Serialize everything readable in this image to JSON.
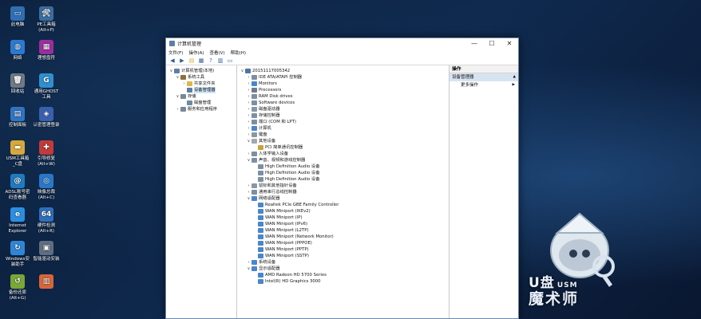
{
  "desktop": {
    "icons": [
      {
        "label": "此电脑",
        "color": "#2f6fb3",
        "glyph": "▭"
      },
      {
        "label": "PE工具箱\n(Alt+P)",
        "color": "#3b6ea0",
        "glyph": "🛠"
      },
      {
        "label": "网络",
        "color": "#2b7ad1",
        "glyph": "◍"
      },
      {
        "label": "理想盘符",
        "color": "#9a2f9e",
        "glyph": "▦"
      },
      {
        "label": "回收站",
        "color": "#6f7a86",
        "glyph": "🗑"
      },
      {
        "label": "通用GHOST\n工具",
        "color": "#2f8fd0",
        "glyph": "G"
      },
      {
        "label": "控制面板",
        "color": "#2f75c4",
        "glyph": "▤"
      },
      {
        "label": "认密管理登录",
        "color": "#3a5fae",
        "glyph": "◈"
      },
      {
        "label": "USM工具箱\n_C盘",
        "color": "#d8a93a",
        "glyph": "▬"
      },
      {
        "label": "引导修复\n(Alt+W)",
        "color": "#c23a3a",
        "glyph": "✚"
      },
      {
        "label": "ADSL账号密\n码查看器",
        "color": "#1f7bc0",
        "glyph": "@"
      },
      {
        "label": "映像总裁\n(Alt+C)",
        "color": "#2a77c9",
        "glyph": "◎"
      },
      {
        "label": "Internet\nExplorer",
        "color": "#2a8fe0",
        "glyph": "e"
      },
      {
        "label": "硬件检测\n(Alt+R)",
        "color": "#2e6fbb",
        "glyph": "64"
      },
      {
        "label": "Windows安\n装助手",
        "color": "#2f86d6",
        "glyph": "↻"
      },
      {
        "label": "智能驱动安装",
        "color": "#5f6f82",
        "glyph": "▣"
      },
      {
        "label": "备份还原\n(Alt+G)",
        "color": "#7aa836",
        "glyph": "↺"
      },
      {
        "label": "",
        "color": "#d4663a",
        "glyph": "▥"
      }
    ]
  },
  "window": {
    "title": "计算机管理",
    "controls": {
      "minimize": "—",
      "maximize": "☐",
      "close": "✕"
    },
    "menu": [
      "文件(F)",
      "操作(A)",
      "查看(V)",
      "帮助(H)"
    ],
    "toolbar_icons": [
      "back-arrow-icon",
      "forward-arrow-icon",
      "folder-up-icon",
      "properties-icon",
      "help-icon",
      "panel-icon",
      "monitor-icon"
    ],
    "left_tree": [
      {
        "label": "计算机管理(本地)",
        "indent": 0,
        "exp": "∨",
        "color": "#5c7fa8"
      },
      {
        "label": "系统工具",
        "indent": 1,
        "exp": "∨",
        "color": "#8c6f3a"
      },
      {
        "label": "共享文件夹",
        "indent": 2,
        "exp": "›",
        "color": "#e0b64a"
      },
      {
        "label": "设备管理器",
        "indent": 2,
        "exp": "",
        "color": "#5a7ea6",
        "selected": true
      },
      {
        "label": "存储",
        "indent": 1,
        "exp": "∨",
        "color": "#7a8796"
      },
      {
        "label": "磁盘管理",
        "indent": 2,
        "exp": "",
        "color": "#6f8aa5"
      },
      {
        "label": "服务和应用程序",
        "indent": 1,
        "exp": "›",
        "color": "#7a8796"
      }
    ],
    "device_tree": [
      {
        "label": "20151117005342",
        "indent": 0,
        "exp": "∨",
        "color": "#4f74a3"
      },
      {
        "label": "IDE ATA/ATAPI 控制器",
        "indent": 1,
        "exp": "›",
        "color": "#7d8fa1"
      },
      {
        "label": "Monitors",
        "indent": 1,
        "exp": "›",
        "color": "#4a86c9"
      },
      {
        "label": "Processors",
        "indent": 1,
        "exp": "›",
        "color": "#6b7c8c"
      },
      {
        "label": "RAM Disk drives",
        "indent": 1,
        "exp": "›",
        "color": "#7d8fa1"
      },
      {
        "label": "Software devices",
        "indent": 1,
        "exp": "›",
        "color": "#7d8fa1"
      },
      {
        "label": "磁盘驱动器",
        "indent": 1,
        "exp": "›",
        "color": "#8a96a3"
      },
      {
        "label": "存储控制器",
        "indent": 1,
        "exp": "›",
        "color": "#7d8fa1"
      },
      {
        "label": "端口 (COM 和 LPT)",
        "indent": 1,
        "exp": "›",
        "color": "#7d8fa1"
      },
      {
        "label": "计算机",
        "indent": 1,
        "exp": "›",
        "color": "#4a86c9"
      },
      {
        "label": "键盘",
        "indent": 1,
        "exp": "›",
        "color": "#8a96a3"
      },
      {
        "label": "其他设备",
        "indent": 1,
        "exp": "∨",
        "color": "#a0a8b0"
      },
      {
        "label": "PCI 简单通讯控制器",
        "indent": 2,
        "exp": "",
        "color": "#c9a23a"
      },
      {
        "label": "人体学输入设备",
        "indent": 1,
        "exp": "›",
        "color": "#7d8fa1"
      },
      {
        "label": "声音、视频和游戏控制器",
        "indent": 1,
        "exp": "∨",
        "color": "#7d8fa1"
      },
      {
        "label": "High Definition Audio 设备",
        "indent": 2,
        "exp": "",
        "color": "#7d8fa1"
      },
      {
        "label": "High Definition Audio 设备",
        "indent": 2,
        "exp": "",
        "color": "#7d8fa1"
      },
      {
        "label": "High Definition Audio 设备",
        "indent": 2,
        "exp": "",
        "color": "#7d8fa1"
      },
      {
        "label": "鼠标和其他指针设备",
        "indent": 1,
        "exp": "›",
        "color": "#8a96a3"
      },
      {
        "label": "通用串行总线控制器",
        "indent": 1,
        "exp": "›",
        "color": "#7d8fa1"
      },
      {
        "label": "网络适配器",
        "indent": 1,
        "exp": "∨",
        "color": "#4a86c9"
      },
      {
        "label": "Realtek PCIe GBE Family Controller",
        "indent": 2,
        "exp": "",
        "color": "#4a86c9"
      },
      {
        "label": "WAN Miniport (IKEv2)",
        "indent": 2,
        "exp": "",
        "color": "#4a86c9"
      },
      {
        "label": "WAN Miniport (IP)",
        "indent": 2,
        "exp": "",
        "color": "#4a86c9"
      },
      {
        "label": "WAN Miniport (IPv6)",
        "indent": 2,
        "exp": "",
        "color": "#4a86c9"
      },
      {
        "label": "WAN Miniport (L2TP)",
        "indent": 2,
        "exp": "",
        "color": "#4a86c9"
      },
      {
        "label": "WAN Miniport (Network Monitor)",
        "indent": 2,
        "exp": "",
        "color": "#4a86c9"
      },
      {
        "label": "WAN Miniport (PPPOE)",
        "indent": 2,
        "exp": "",
        "color": "#4a86c9"
      },
      {
        "label": "WAN Miniport (PPTP)",
        "indent": 2,
        "exp": "",
        "color": "#4a86c9"
      },
      {
        "label": "WAN Miniport (SSTP)",
        "indent": 2,
        "exp": "",
        "color": "#4a86c9"
      },
      {
        "label": "系统设备",
        "indent": 1,
        "exp": "›",
        "color": "#4a86c9"
      },
      {
        "label": "显示适配器",
        "indent": 1,
        "exp": "∨",
        "color": "#4a86c9"
      },
      {
        "label": "AMD Radeon HD 5700 Series",
        "indent": 2,
        "exp": "",
        "color": "#4a86c9"
      },
      {
        "label": "Intel(R) HD Graphics 3000",
        "indent": 2,
        "exp": "",
        "color": "#4a86c9"
      }
    ],
    "actions": {
      "header": "操作",
      "section": "设备管理器",
      "section_arrow": "▲",
      "more": "更多操作",
      "more_arrow": "▶"
    }
  },
  "branding": {
    "line1": "U盘",
    "line1_small": "USM",
    "line2": "魔术师"
  }
}
